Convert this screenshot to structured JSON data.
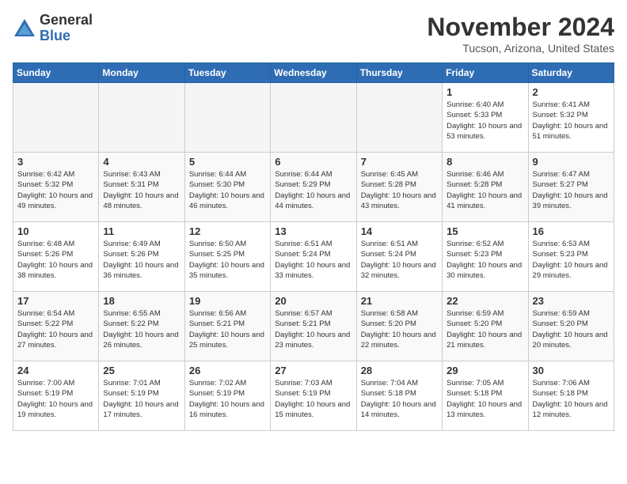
{
  "header": {
    "logo_line1": "General",
    "logo_line2": "Blue",
    "month_title": "November 2024",
    "location": "Tucson, Arizona, United States"
  },
  "weekdays": [
    "Sunday",
    "Monday",
    "Tuesday",
    "Wednesday",
    "Thursday",
    "Friday",
    "Saturday"
  ],
  "weeks": [
    [
      {
        "day": "",
        "info": ""
      },
      {
        "day": "",
        "info": ""
      },
      {
        "day": "",
        "info": ""
      },
      {
        "day": "",
        "info": ""
      },
      {
        "day": "",
        "info": ""
      },
      {
        "day": "1",
        "info": "Sunrise: 6:40 AM\nSunset: 5:33 PM\nDaylight: 10 hours and 53 minutes."
      },
      {
        "day": "2",
        "info": "Sunrise: 6:41 AM\nSunset: 5:32 PM\nDaylight: 10 hours and 51 minutes."
      }
    ],
    [
      {
        "day": "3",
        "info": "Sunrise: 6:42 AM\nSunset: 5:32 PM\nDaylight: 10 hours and 49 minutes."
      },
      {
        "day": "4",
        "info": "Sunrise: 6:43 AM\nSunset: 5:31 PM\nDaylight: 10 hours and 48 minutes."
      },
      {
        "day": "5",
        "info": "Sunrise: 6:44 AM\nSunset: 5:30 PM\nDaylight: 10 hours and 46 minutes."
      },
      {
        "day": "6",
        "info": "Sunrise: 6:44 AM\nSunset: 5:29 PM\nDaylight: 10 hours and 44 minutes."
      },
      {
        "day": "7",
        "info": "Sunrise: 6:45 AM\nSunset: 5:28 PM\nDaylight: 10 hours and 43 minutes."
      },
      {
        "day": "8",
        "info": "Sunrise: 6:46 AM\nSunset: 5:28 PM\nDaylight: 10 hours and 41 minutes."
      },
      {
        "day": "9",
        "info": "Sunrise: 6:47 AM\nSunset: 5:27 PM\nDaylight: 10 hours and 39 minutes."
      }
    ],
    [
      {
        "day": "10",
        "info": "Sunrise: 6:48 AM\nSunset: 5:26 PM\nDaylight: 10 hours and 38 minutes."
      },
      {
        "day": "11",
        "info": "Sunrise: 6:49 AM\nSunset: 5:26 PM\nDaylight: 10 hours and 36 minutes."
      },
      {
        "day": "12",
        "info": "Sunrise: 6:50 AM\nSunset: 5:25 PM\nDaylight: 10 hours and 35 minutes."
      },
      {
        "day": "13",
        "info": "Sunrise: 6:51 AM\nSunset: 5:24 PM\nDaylight: 10 hours and 33 minutes."
      },
      {
        "day": "14",
        "info": "Sunrise: 6:51 AM\nSunset: 5:24 PM\nDaylight: 10 hours and 32 minutes."
      },
      {
        "day": "15",
        "info": "Sunrise: 6:52 AM\nSunset: 5:23 PM\nDaylight: 10 hours and 30 minutes."
      },
      {
        "day": "16",
        "info": "Sunrise: 6:53 AM\nSunset: 5:23 PM\nDaylight: 10 hours and 29 minutes."
      }
    ],
    [
      {
        "day": "17",
        "info": "Sunrise: 6:54 AM\nSunset: 5:22 PM\nDaylight: 10 hours and 27 minutes."
      },
      {
        "day": "18",
        "info": "Sunrise: 6:55 AM\nSunset: 5:22 PM\nDaylight: 10 hours and 26 minutes."
      },
      {
        "day": "19",
        "info": "Sunrise: 6:56 AM\nSunset: 5:21 PM\nDaylight: 10 hours and 25 minutes."
      },
      {
        "day": "20",
        "info": "Sunrise: 6:57 AM\nSunset: 5:21 PM\nDaylight: 10 hours and 23 minutes."
      },
      {
        "day": "21",
        "info": "Sunrise: 6:58 AM\nSunset: 5:20 PM\nDaylight: 10 hours and 22 minutes."
      },
      {
        "day": "22",
        "info": "Sunrise: 6:59 AM\nSunset: 5:20 PM\nDaylight: 10 hours and 21 minutes."
      },
      {
        "day": "23",
        "info": "Sunrise: 6:59 AM\nSunset: 5:20 PM\nDaylight: 10 hours and 20 minutes."
      }
    ],
    [
      {
        "day": "24",
        "info": "Sunrise: 7:00 AM\nSunset: 5:19 PM\nDaylight: 10 hours and 19 minutes."
      },
      {
        "day": "25",
        "info": "Sunrise: 7:01 AM\nSunset: 5:19 PM\nDaylight: 10 hours and 17 minutes."
      },
      {
        "day": "26",
        "info": "Sunrise: 7:02 AM\nSunset: 5:19 PM\nDaylight: 10 hours and 16 minutes."
      },
      {
        "day": "27",
        "info": "Sunrise: 7:03 AM\nSunset: 5:19 PM\nDaylight: 10 hours and 15 minutes."
      },
      {
        "day": "28",
        "info": "Sunrise: 7:04 AM\nSunset: 5:18 PM\nDaylight: 10 hours and 14 minutes."
      },
      {
        "day": "29",
        "info": "Sunrise: 7:05 AM\nSunset: 5:18 PM\nDaylight: 10 hours and 13 minutes."
      },
      {
        "day": "30",
        "info": "Sunrise: 7:06 AM\nSunset: 5:18 PM\nDaylight: 10 hours and 12 minutes."
      }
    ]
  ]
}
